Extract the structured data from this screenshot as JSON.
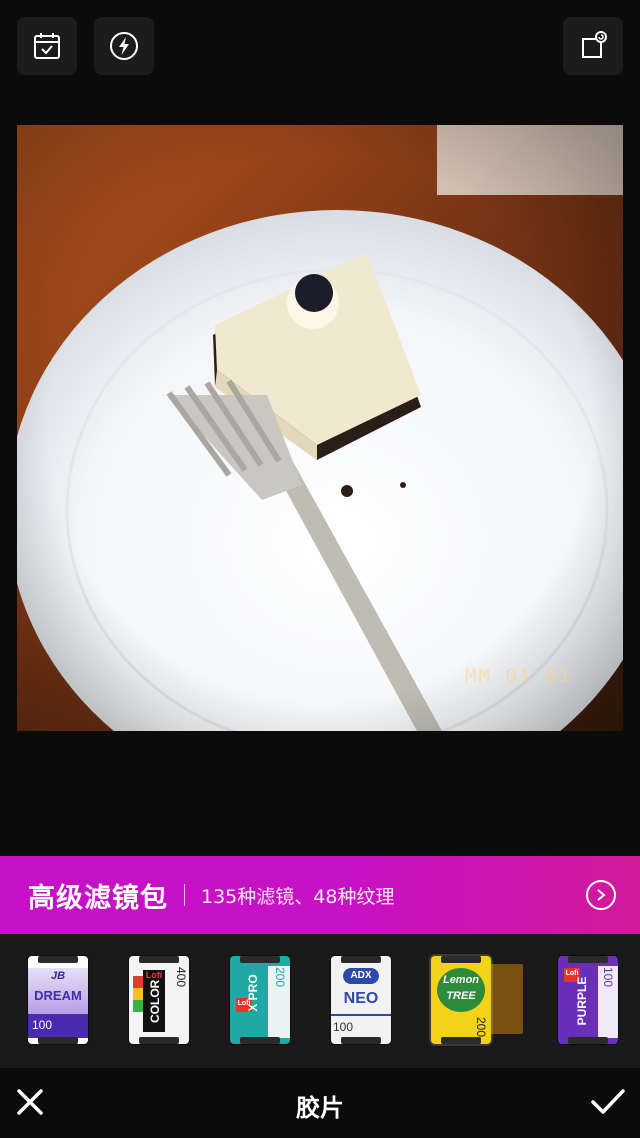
{
  "toolbar": {
    "left": [
      "calendar-icon",
      "flash-icon"
    ],
    "right": [
      "export-icon"
    ]
  },
  "photo": {
    "date_stamp": "MM  01 01"
  },
  "promo": {
    "title": "高级滤镜包",
    "subtitle": "135种滤镜、48种纹理"
  },
  "films": [
    {
      "brand": "JB",
      "name": "DREAM",
      "iso": "100",
      "color": "#ffffff",
      "selected": false
    },
    {
      "brand": "Lofi",
      "name": "COLOR",
      "iso": "400",
      "color": "#f4f4f4",
      "selected": false
    },
    {
      "brand": "Lofi",
      "name": "X PRO",
      "iso": "200",
      "color": "#1fa9a4",
      "selected": false
    },
    {
      "brand": "ADX",
      "name": "NEO",
      "iso": "100",
      "color": "#f2f2f2",
      "selected": false
    },
    {
      "brand": "Lemon",
      "name": "TREE",
      "iso": "200",
      "color": "#f3d21a",
      "selected": true
    },
    {
      "brand": "Lofi",
      "name": "PURPLE",
      "iso": "100",
      "color": "#6a2fb8",
      "selected": false
    }
  ],
  "bottom": {
    "title": "胶片"
  }
}
